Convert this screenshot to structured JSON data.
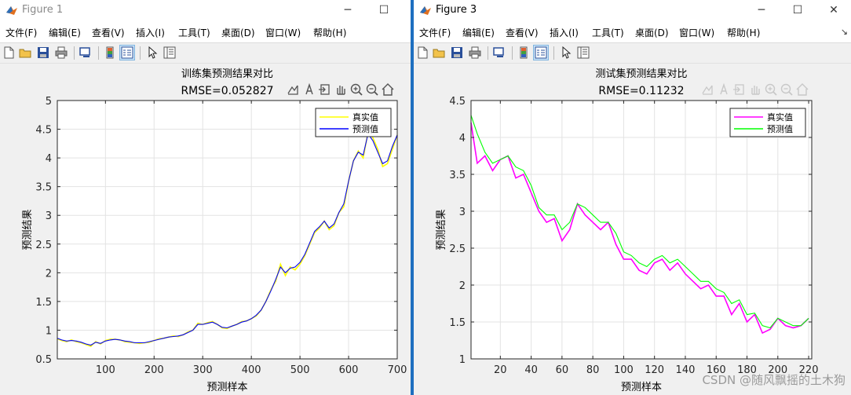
{
  "windows": [
    {
      "title": "Figure 1",
      "menu": [
        "文件(F)",
        "编辑(E)",
        "查看(V)",
        "插入(I)",
        "工具(T)",
        "桌面(D)",
        "窗口(W)",
        "帮助(H)"
      ],
      "chart_data": {
        "type": "line",
        "title": "训练集预测结果对比",
        "subtitle": "RMSE=0.052827",
        "xlabel": "预测样本",
        "ylabel": "预测结果",
        "xlim": [
          1,
          700
        ],
        "ylim": [
          0.5,
          5
        ],
        "xticks": [
          100,
          200,
          300,
          400,
          500,
          600,
          700
        ],
        "yticks": [
          0.5,
          1,
          1.5,
          2,
          2.5,
          3,
          3.5,
          4,
          4.5,
          5
        ],
        "grid": true,
        "legend_position": "top-right",
        "series": [
          {
            "name": "真实值",
            "color": "#ffff00",
            "x": [
              1,
              10,
              20,
              30,
              40,
              50,
              60,
              70,
              80,
              90,
              100,
              110,
              120,
              130,
              140,
              150,
              160,
              170,
              180,
              190,
              200,
              210,
              220,
              230,
              240,
              250,
              260,
              270,
              280,
              290,
              300,
              310,
              320,
              330,
              340,
              350,
              360,
              370,
              380,
              390,
              400,
              410,
              420,
              430,
              440,
              450,
              460,
              470,
              480,
              490,
              500,
              510,
              520,
              530,
              540,
              550,
              560,
              570,
              580,
              590,
              600,
              610,
              620,
              630,
              640,
              650,
              660,
              670,
              680,
              690,
              700
            ],
            "values": [
              0.85,
              0.82,
              0.8,
              0.83,
              0.8,
              0.78,
              0.75,
              0.72,
              0.8,
              0.76,
              0.82,
              0.84,
              0.84,
              0.83,
              0.8,
              0.79,
              0.78,
              0.77,
              0.78,
              0.79,
              0.82,
              0.85,
              0.86,
              0.88,
              0.9,
              0.89,
              0.92,
              0.97,
              1.0,
              1.12,
              1.1,
              1.13,
              1.15,
              1.1,
              1.04,
              1.03,
              1.07,
              1.1,
              1.15,
              1.16,
              1.2,
              1.25,
              1.35,
              1.5,
              1.7,
              1.85,
              2.15,
              1.95,
              2.1,
              2.05,
              2.15,
              2.3,
              2.5,
              2.7,
              2.78,
              2.9,
              2.75,
              2.82,
              3.05,
              3.15,
              3.6,
              3.95,
              4.12,
              4.0,
              4.45,
              4.35,
              4.15,
              3.85,
              3.9,
              4.15,
              4.4
            ]
          },
          {
            "name": "预测值",
            "color": "#0000ff",
            "x": [
              1,
              10,
              20,
              30,
              40,
              50,
              60,
              70,
              80,
              90,
              100,
              110,
              120,
              130,
              140,
              150,
              160,
              170,
              180,
              190,
              200,
              210,
              220,
              230,
              240,
              250,
              260,
              270,
              280,
              290,
              300,
              310,
              320,
              330,
              340,
              350,
              360,
              370,
              380,
              390,
              400,
              410,
              420,
              430,
              440,
              450,
              460,
              470,
              480,
              490,
              500,
              510,
              520,
              530,
              540,
              550,
              560,
              570,
              580,
              590,
              600,
              610,
              620,
              630,
              640,
              650,
              660,
              670,
              680,
              690,
              700
            ],
            "values": [
              0.86,
              0.83,
              0.81,
              0.82,
              0.81,
              0.79,
              0.76,
              0.74,
              0.79,
              0.77,
              0.81,
              0.83,
              0.84,
              0.83,
              0.81,
              0.8,
              0.78,
              0.78,
              0.78,
              0.8,
              0.82,
              0.84,
              0.86,
              0.88,
              0.89,
              0.9,
              0.92,
              0.96,
              1.0,
              1.1,
              1.1,
              1.12,
              1.14,
              1.1,
              1.05,
              1.04,
              1.07,
              1.1,
              1.14,
              1.16,
              1.2,
              1.26,
              1.35,
              1.5,
              1.68,
              1.88,
              2.1,
              2.0,
              2.08,
              2.1,
              2.18,
              2.32,
              2.52,
              2.72,
              2.8,
              2.9,
              2.78,
              2.85,
              3.05,
              3.2,
              3.6,
              3.95,
              4.1,
              4.05,
              4.42,
              4.3,
              4.1,
              3.9,
              3.95,
              4.2,
              4.4
            ]
          }
        ]
      }
    },
    {
      "title": "Figure 3",
      "menu": [
        "文件(F)",
        "编辑(E)",
        "查看(V)",
        "插入(I)",
        "工具(T)",
        "桌面(D)",
        "窗口(W)",
        "帮助(H)"
      ],
      "chart_data": {
        "type": "line",
        "title": "测试集预测结果对比",
        "subtitle": "RMSE=0.11232",
        "xlabel": "预测样本",
        "ylabel": "预测结果",
        "xlim": [
          1,
          222
        ],
        "ylim": [
          1,
          4.5
        ],
        "xticks": [
          20,
          40,
          60,
          80,
          100,
          120,
          140,
          160,
          180,
          200,
          220
        ],
        "yticks": [
          1,
          1.5,
          2,
          2.5,
          3,
          3.5,
          4,
          4.5
        ],
        "grid": true,
        "legend_position": "top-right",
        "series": [
          {
            "name": "真实值",
            "color": "#ff00ff",
            "x": [
              1,
              5,
              10,
              15,
              20,
              25,
              30,
              35,
              40,
              45,
              50,
              55,
              60,
              65,
              70,
              75,
              80,
              85,
              90,
              95,
              100,
              105,
              110,
              115,
              120,
              125,
              130,
              135,
              140,
              145,
              150,
              155,
              160,
              165,
              170,
              175,
              180,
              185,
              190,
              195,
              200,
              205,
              210,
              215,
              220
            ],
            "values": [
              4.2,
              3.65,
              3.75,
              3.55,
              3.7,
              3.75,
              3.45,
              3.5,
              3.25,
              3.0,
              2.85,
              2.9,
              2.6,
              2.75,
              3.1,
              2.95,
              2.85,
              2.75,
              2.85,
              2.55,
              2.35,
              2.35,
              2.2,
              2.15,
              2.3,
              2.35,
              2.2,
              2.3,
              2.15,
              2.05,
              1.95,
              2.0,
              1.85,
              1.85,
              1.6,
              1.75,
              1.5,
              1.6,
              1.35,
              1.4,
              1.55,
              1.45,
              1.42,
              1.45,
              1.55
            ]
          },
          {
            "name": "预测值",
            "color": "#00ff00",
            "x": [
              1,
              5,
              10,
              15,
              20,
              25,
              30,
              35,
              40,
              45,
              50,
              55,
              60,
              65,
              70,
              75,
              80,
              85,
              90,
              95,
              100,
              105,
              110,
              115,
              120,
              125,
              130,
              135,
              140,
              145,
              150,
              155,
              160,
              165,
              170,
              175,
              180,
              185,
              190,
              195,
              200,
              205,
              210,
              215,
              220
            ],
            "values": [
              4.3,
              4.05,
              3.8,
              3.65,
              3.7,
              3.75,
              3.6,
              3.55,
              3.35,
              3.05,
              2.95,
              2.95,
              2.75,
              2.85,
              3.1,
              3.05,
              2.95,
              2.85,
              2.85,
              2.7,
              2.45,
              2.4,
              2.3,
              2.25,
              2.35,
              2.4,
              2.3,
              2.35,
              2.25,
              2.15,
              2.05,
              2.05,
              1.95,
              1.9,
              1.75,
              1.8,
              1.6,
              1.62,
              1.45,
              1.42,
              1.55,
              1.5,
              1.45,
              1.45,
              1.55
            ]
          }
        ]
      }
    }
  ],
  "watermark": "CSDN @随风飘摇的土木狗"
}
